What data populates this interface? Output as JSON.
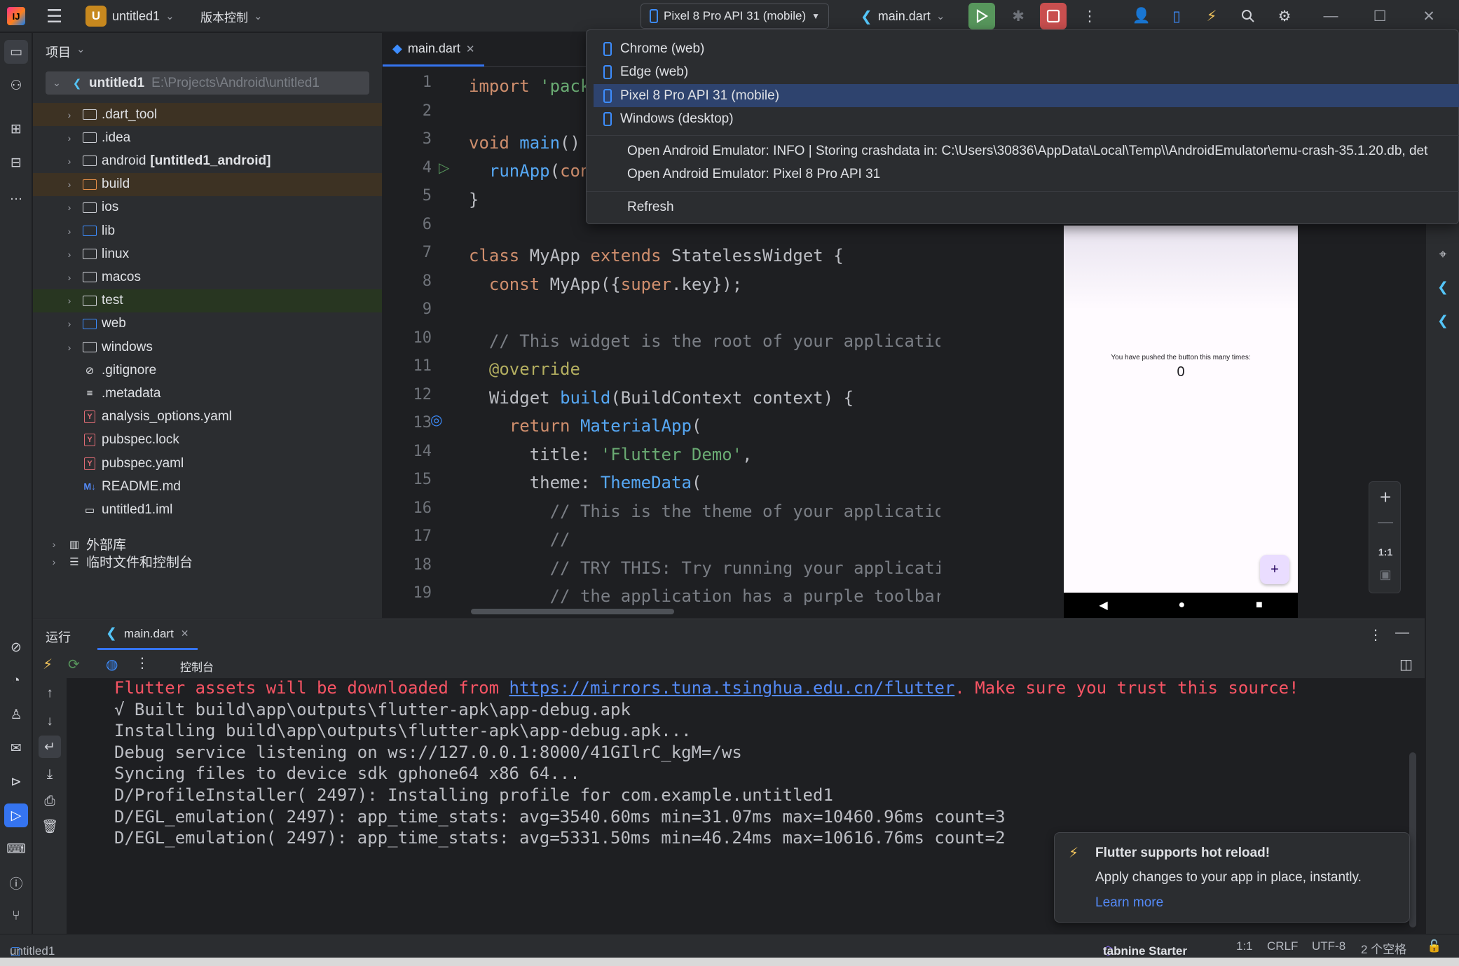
{
  "titlebar": {
    "project_initial": "U",
    "project_name": "untitled1",
    "vcs_label": "版本控制",
    "device_selector": "Pixel 8 Pro API 31 (mobile)",
    "run_config": "main.dart"
  },
  "project_panel": {
    "title": "项目",
    "root_name": "untitled1",
    "root_path": "E:\\Projects\\Android\\untitled1",
    "items": [
      {
        "label": ".dart_tool",
        "kind": "folder"
      },
      {
        "label": ".idea",
        "kind": "folder"
      },
      {
        "label": "android",
        "suffix": "[untitled1_android]",
        "kind": "folder"
      },
      {
        "label": "build",
        "kind": "folder"
      },
      {
        "label": "ios",
        "kind": "folder"
      },
      {
        "label": "lib",
        "kind": "folder"
      },
      {
        "label": "linux",
        "kind": "folder"
      },
      {
        "label": "macos",
        "kind": "folder"
      },
      {
        "label": "test",
        "kind": "folder"
      },
      {
        "label": "web",
        "kind": "folder"
      },
      {
        "label": "windows",
        "kind": "folder"
      },
      {
        "label": ".gitignore",
        "kind": "gitignore"
      },
      {
        "label": ".metadata",
        "kind": "text"
      },
      {
        "label": "analysis_options.yaml",
        "kind": "yaml"
      },
      {
        "label": "pubspec.lock",
        "kind": "yaml"
      },
      {
        "label": "pubspec.yaml",
        "kind": "yaml"
      },
      {
        "label": "README.md",
        "kind": "md"
      },
      {
        "label": "untitled1.iml",
        "kind": "iml"
      }
    ],
    "external_libs": "外部库",
    "scratches": "临时文件和控制台"
  },
  "editor": {
    "tab": "main.dart",
    "line_numbers": [
      "1",
      "2",
      "3",
      "4",
      "5",
      "6",
      "7",
      "8",
      "9",
      "10",
      "11",
      "12",
      "13",
      "14",
      "15",
      "16",
      "17",
      "18",
      "19"
    ]
  },
  "emulator": {
    "counter_caption": "You have pushed the button this many times:",
    "counter_value": "0",
    "fab_symbol": "+",
    "zoom_ratio": "1:1"
  },
  "device_dropdown": {
    "devices": [
      "Chrome (web)",
      "Edge (web)",
      "Pixel 8 Pro API 31 (mobile)",
      "Windows (desktop)"
    ],
    "selected_index": 2,
    "actions": [
      "Open Android Emulator: INFO    | Storing crashdata in: C:\\Users\\30836\\AppData\\Local\\Temp\\\\AndroidEmulator\\emu-crash-35.1.20.db, det",
      "Open Android Emulator: Pixel 8 Pro API 31"
    ],
    "refresh": "Refresh"
  },
  "run_panel": {
    "title": "运行",
    "tab": "main.dart",
    "console_label": "控制台",
    "lines": [
      {
        "pre": "Flutter assets will be downloaded from ",
        "link": "https://mirrors.tuna.tsinghua.edu.cn/flutter",
        "post": ". Make sure you trust this source!",
        "color": "#f75464"
      },
      {
        "text": "√ Built build\\app\\outputs\\flutter-apk\\app-debug.apk",
        "color": "#bcbec4"
      },
      {
        "text": "Installing build\\app\\outputs\\flutter-apk\\app-debug.apk...",
        "color": "#bcbec4"
      },
      {
        "text": "Debug service listening on ws://127.0.0.1:8000/41GIlrC_kgM=/ws",
        "color": "#bcbec4"
      },
      {
        "text": "Syncing files to device sdk gphone64 x86 64...",
        "color": "#bcbec4"
      },
      {
        "text": "D/ProfileInstaller( 2497): Installing profile for com.example.untitled1",
        "color": "#bcbec4"
      },
      {
        "text": "D/EGL_emulation( 2497): app_time_stats: avg=3540.60ms min=31.07ms max=10460.96ms count=3",
        "color": "#bcbec4"
      },
      {
        "text": "D/EGL_emulation( 2497): app_time_stats: avg=5331.50ms min=46.24ms max=10616.76ms count=2",
        "color": "#bcbec4"
      }
    ]
  },
  "notification": {
    "title": "Flutter supports hot reload!",
    "body": "Apply changes to your app in place, instantly.",
    "link": "Learn more"
  },
  "statusbar": {
    "project": "untitled1",
    "plugin": "tabnine Starter",
    "position": "1:1",
    "line_sep": "CRLF",
    "encoding": "UTF-8",
    "indent": "2 个空格"
  },
  "colors": {
    "accent": "#3574f0",
    "run_green": "#57965c",
    "stop_red": "#c94f4f",
    "error_text": "#f75464",
    "link": "#548af7"
  }
}
